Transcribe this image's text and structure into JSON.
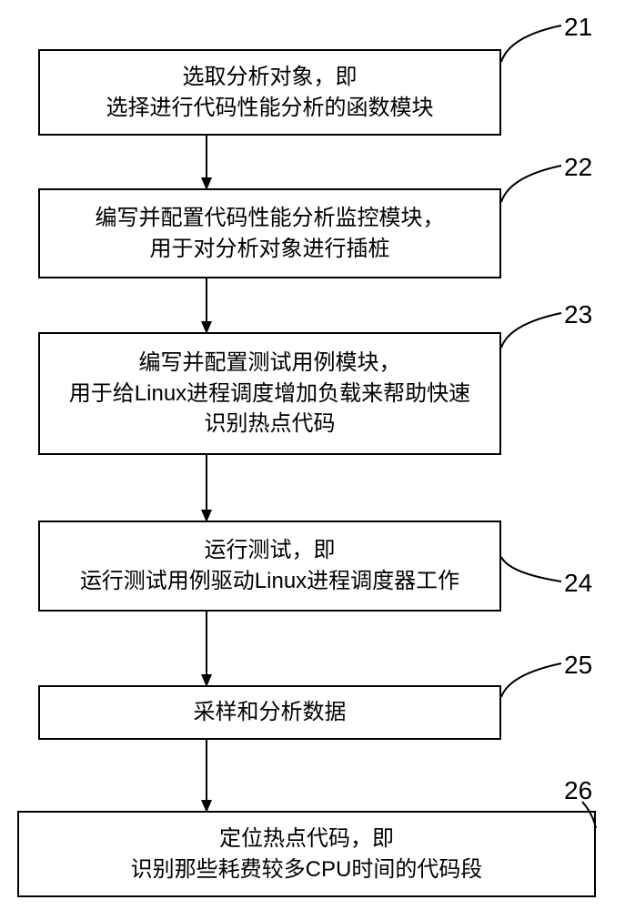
{
  "chart_data": {
    "type": "flowchart",
    "steps": [
      {
        "id": "21",
        "line1": "选取分析对象，即",
        "line2": "选择进行代码性能分析的函数模块"
      },
      {
        "id": "22",
        "line1": "编写并配置代码性能分析监控模块，",
        "line2": "用于对分析对象进行插桩"
      },
      {
        "id": "23",
        "line1": "编写并配置测试用例模块，",
        "line2": "用于给Linux进程调度增加负载来帮助快速",
        "line3": "识别热点代码"
      },
      {
        "id": "24",
        "line1": "运行测试，即",
        "line2": "运行测试用例驱动Linux进程调度器工作"
      },
      {
        "id": "25",
        "line1": "采样和分析数据",
        "line2": ""
      },
      {
        "id": "26",
        "line1": "定位热点代码，即",
        "line2": "识别那些耗费较多CPU时间的代码段"
      }
    ]
  }
}
